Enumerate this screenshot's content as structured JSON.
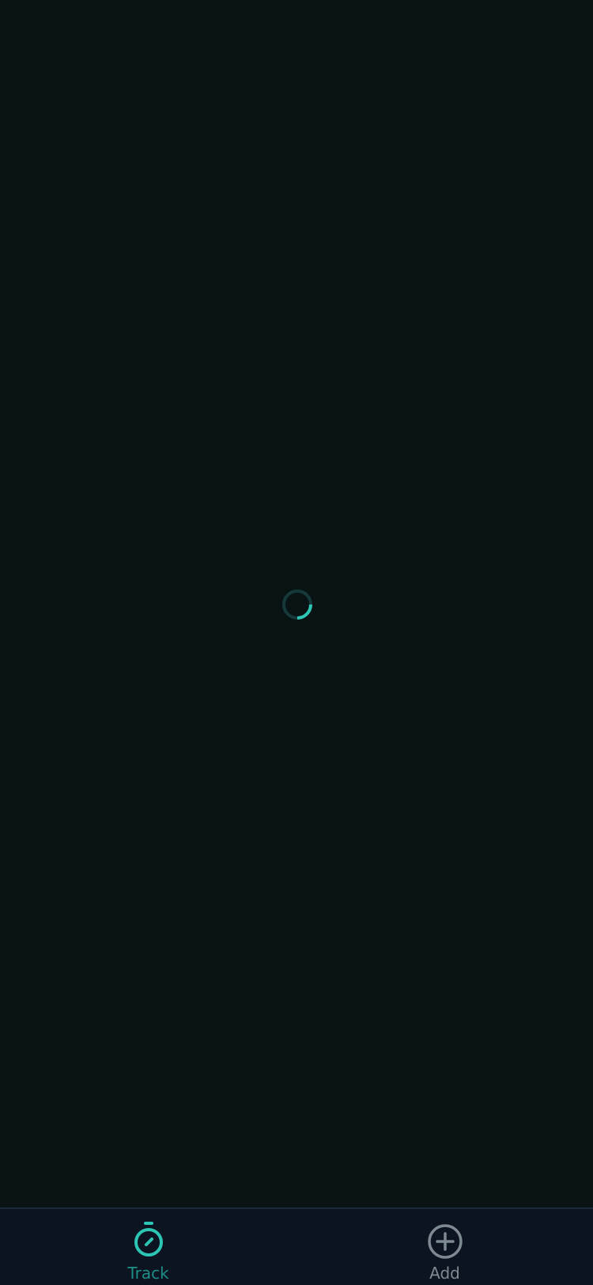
{
  "screen": {
    "background_color": "#091314"
  },
  "loading": {
    "spinner_icon": "loading-spinner-icon",
    "accent_color": "#2dc5b4",
    "track_color": "#16393a"
  },
  "tabbar": {
    "background_color": "#0c1421",
    "tabs": [
      {
        "label": "Track",
        "icon": "stopwatch-icon",
        "active": true,
        "color": "#2dc5b4"
      },
      {
        "label": "Add",
        "icon": "plus-circle-icon",
        "active": false,
        "color": "#7d8a92"
      }
    ]
  }
}
